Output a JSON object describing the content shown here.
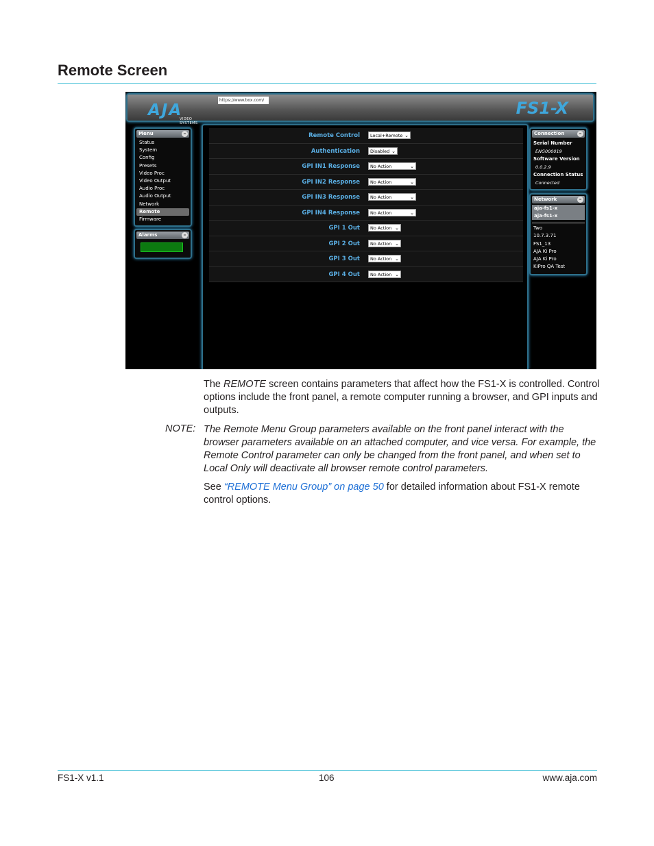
{
  "page": {
    "title": "Remote Screen",
    "footer_left": "FS1-X v1.1",
    "footer_center": "106",
    "footer_right": "www.aja.com"
  },
  "screenshot": {
    "url": "https://www.box.com/",
    "logo": "AJA",
    "logo_sub": "VIDEO SYSTEMS",
    "product": "FS1-X",
    "menu": {
      "title": "Menu",
      "items": [
        "Status",
        "System",
        "Config",
        "Presets",
        "Video Proc",
        "Video Output",
        "Audio Proc",
        "Audio Output",
        "Network",
        "Remote",
        "Firmware"
      ],
      "active": "Remote"
    },
    "alarms": {
      "title": "Alarms",
      "status_color": "#0c7a10"
    },
    "params": [
      {
        "label": "Remote Control",
        "value": "Local+Remote"
      },
      {
        "label": "Authentication",
        "value": "Disabled"
      },
      {
        "label": "GPI IN1 Response",
        "value": "No Action"
      },
      {
        "label": "GPI IN2 Response",
        "value": "No Action"
      },
      {
        "label": "GPI IN3 Response",
        "value": "No Action"
      },
      {
        "label": "GPI IN4 Response",
        "value": "No Action"
      },
      {
        "label": "GPI 1 Out",
        "value": "No Action"
      },
      {
        "label": "GPI 2 Out",
        "value": "No Action"
      },
      {
        "label": "GPI 3 Out",
        "value": "No Action"
      },
      {
        "label": "GPI 4 Out",
        "value": "No Action"
      }
    ],
    "connection": {
      "title": "Connection",
      "serial_label": "Serial Number",
      "serial_value": "ENG000019",
      "software_label": "Software Version",
      "software_value": "0.0.2.9",
      "status_label": "Connection Status",
      "status_value": "Connected"
    },
    "network": {
      "title": "Network",
      "items": [
        "aja-fs1-x",
        "aja-fs1-x"
      ],
      "devices": [
        "Two",
        "10.7.3.71",
        "FS1_13",
        "AJA Ki Pro",
        "AJA Ki Pro",
        "KiPro QA Test"
      ]
    }
  },
  "body": {
    "p1_a": "The ",
    "p1_em": "REMOTE",
    "p1_b": " screen contains parameters that affect how the FS1-X is controlled. Control options include the front panel, a remote computer running a browser, and GPI inputs and outputs.",
    "note_label": "NOTE:",
    "note_text": "The Remote Menu Group parameters available on the front panel interact with the browser parameters available on an attached computer, and vice versa. For example, the Remote Control parameter can only be changed from the front panel, and when set to Local Only will deactivate all browser remote control parameters.",
    "p2_a": "See ",
    "p2_link": "“REMOTE Menu Group” on page 50",
    "p2_b": " for detailed information about FS1-X remote control options."
  }
}
